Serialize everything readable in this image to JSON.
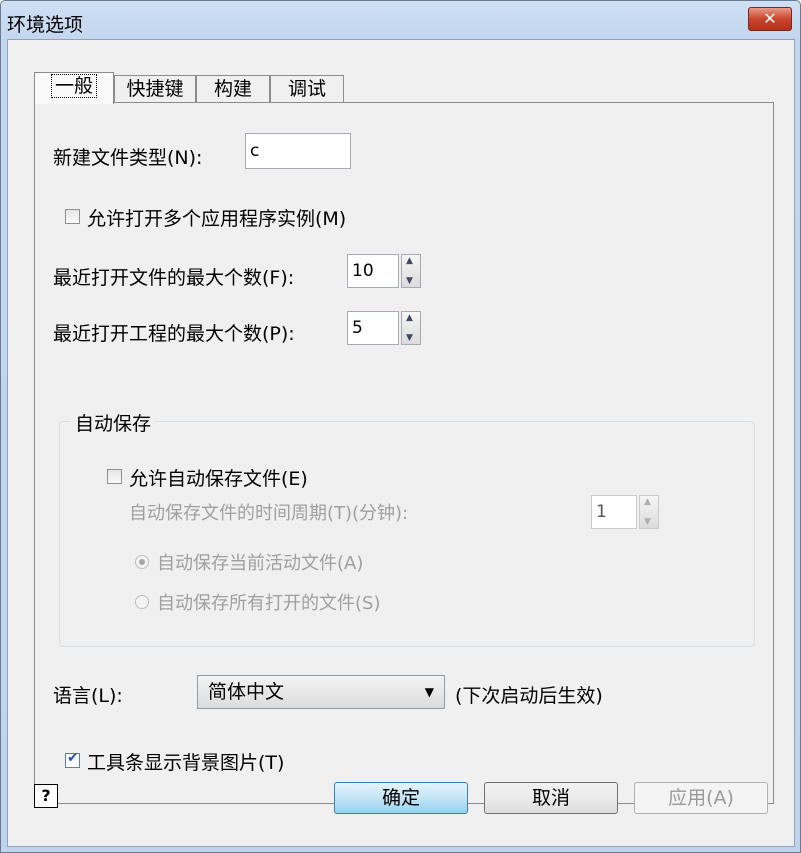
{
  "window": {
    "title": "环境选项",
    "close_label": "✕"
  },
  "tabs": [
    {
      "label": "一般",
      "active": true
    },
    {
      "label": "快捷键",
      "active": false
    },
    {
      "label": "构建",
      "active": false
    },
    {
      "label": "调试",
      "active": false
    }
  ],
  "general": {
    "new_file_type_label": "新建文件类型(N):",
    "new_file_type_value": "c",
    "allow_multi_instance_label": "允许打开多个应用程序实例(M)",
    "allow_multi_instance_checked": false,
    "recent_files_label": "最近打开文件的最大个数(F):",
    "recent_files_value": "10",
    "recent_projects_label": "最近打开工程的最大个数(P):",
    "recent_projects_value": "5"
  },
  "autosave": {
    "group_title": "自动保存",
    "enable_label": "允许自动保存文件(E)",
    "enable_checked": false,
    "period_label": "自动保存文件的时间周期(T)(分钟):",
    "period_value": "1",
    "radio_current_label": "自动保存当前活动文件(A)",
    "radio_all_label": "自动保存所有打开的文件(S)",
    "selected": "current"
  },
  "language": {
    "label": "语言(L):",
    "selected": "简体中文",
    "note": "(下次启动后生效)"
  },
  "toolbar_bg": {
    "label": "工具条显示背景图片(T)",
    "checked": true
  },
  "buttons": {
    "help": "?",
    "ok": "确定",
    "cancel": "取消",
    "apply": "应用(A)"
  }
}
